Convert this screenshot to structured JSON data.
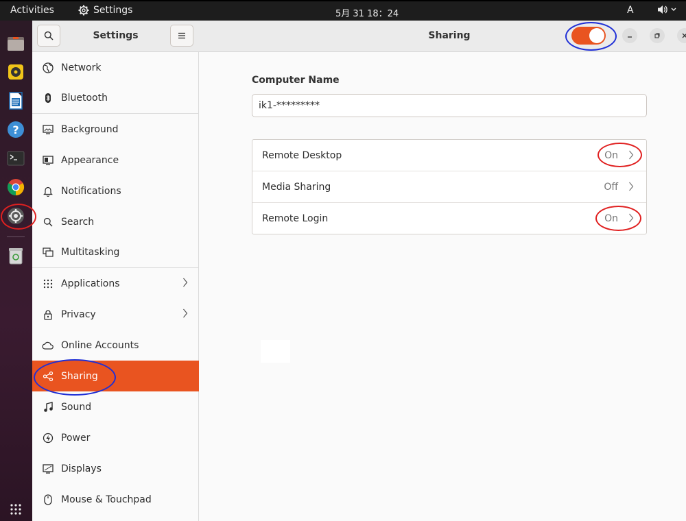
{
  "topbar": {
    "activities": "Activities",
    "app_name": "Settings",
    "clock": "5月 31  18：24",
    "keyboard": "A"
  },
  "dock": {
    "items": [
      "files-icon",
      "rhythmbox-icon",
      "writer-icon",
      "help-icon",
      "terminal-icon",
      "chrome-icon",
      "settings-icon",
      "trash-icon",
      "app-grid-icon"
    ]
  },
  "sidebar": {
    "title": "Settings",
    "items": [
      {
        "label": "Network"
      },
      {
        "label": "Bluetooth"
      },
      {
        "label": "Background"
      },
      {
        "label": "Appearance"
      },
      {
        "label": "Notifications"
      },
      {
        "label": "Search"
      },
      {
        "label": "Multitasking"
      },
      {
        "label": "Applications"
      },
      {
        "label": "Privacy"
      },
      {
        "label": "Online Accounts"
      },
      {
        "label": "Sharing"
      },
      {
        "label": "Sound"
      },
      {
        "label": "Power"
      },
      {
        "label": "Displays"
      },
      {
        "label": "Mouse & Touchpad"
      }
    ]
  },
  "main": {
    "title": "Sharing",
    "sharing_enabled": true,
    "computer_name_label": "Computer Name",
    "computer_name_value": "ik1-*********",
    "services": [
      {
        "name": "Remote Desktop",
        "state": "On"
      },
      {
        "name": "Media Sharing",
        "state": "Off"
      },
      {
        "name": "Remote Login",
        "state": "On"
      }
    ]
  },
  "colors": {
    "accent": "#e95420",
    "annotation_red": "#e02020",
    "annotation_blue": "#1f2fd6"
  }
}
